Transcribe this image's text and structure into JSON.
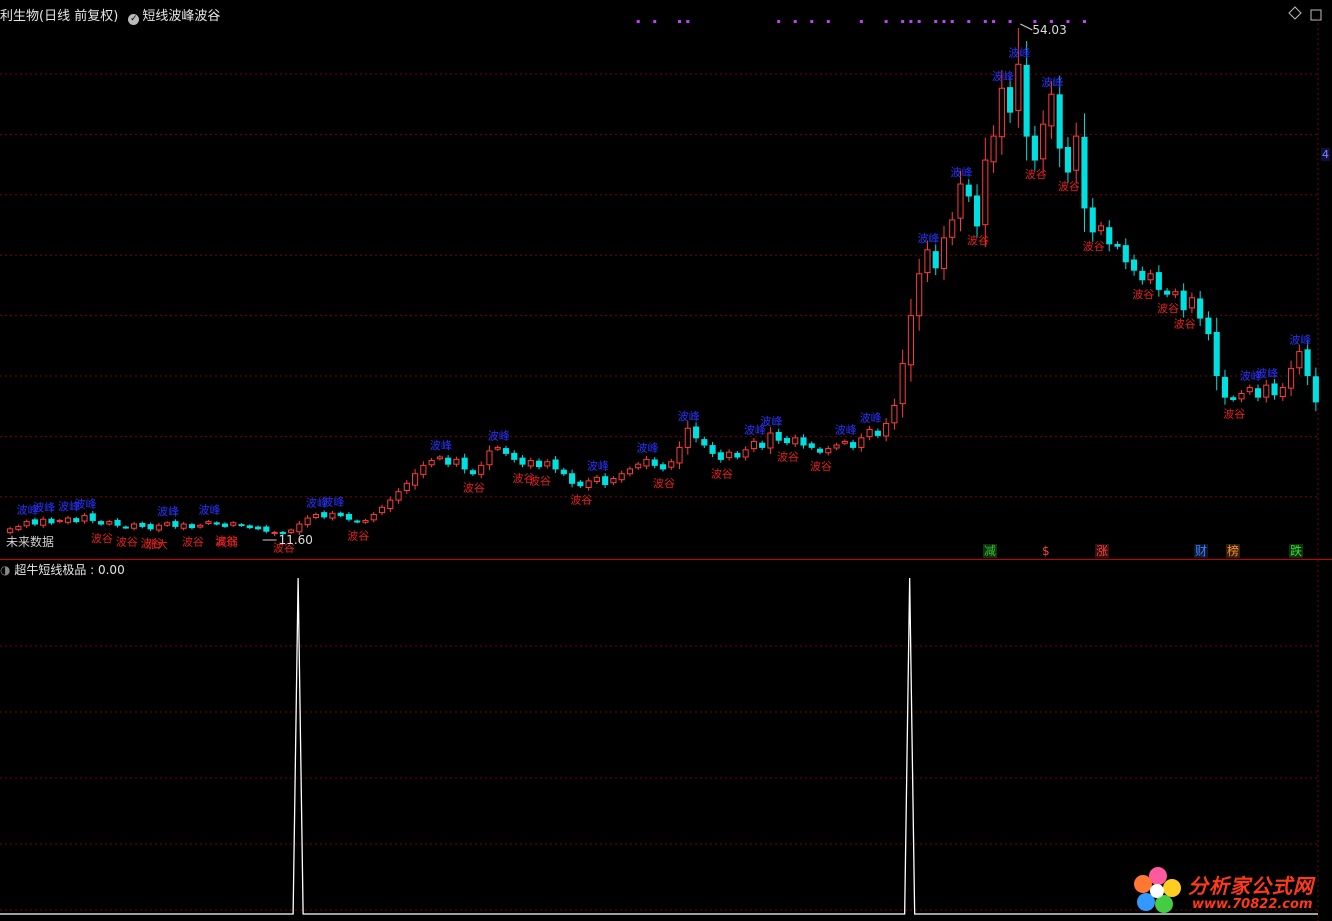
{
  "header": {
    "stock_title": "利生物(日线 前复权)",
    "indicator_name": "短线波峰波谷"
  },
  "indicator_panel": {
    "label": "超牛短线极品 : 0.00"
  },
  "price_labels": {
    "high": "54.03",
    "low": "11.60",
    "right_edge": "4"
  },
  "watermark": {
    "line1": "分析家公式网",
    "line2": "www.70822.com"
  },
  "colors": {
    "up": "#ff3c3c",
    "down": "#00e0e0",
    "peak_label": "#2a32ff",
    "valley_label": "#e02020",
    "grid": "#7a0000",
    "separator": "#c80000",
    "marker": "#c040ff"
  },
  "event_tags": [
    {
      "text": "减",
      "color": "#30c030",
      "bg": "#103010"
    },
    {
      "text": "$",
      "color": "#ff4040",
      "bg": "#000"
    },
    {
      "text": "涨",
      "color": "#ff4040",
      "bg": "#301010"
    },
    {
      "text": "财",
      "color": "#4080ff",
      "bg": "#101830"
    },
    {
      "text": "榜",
      "color": "#ff9030",
      "bg": "#302010"
    },
    {
      "text": "跌",
      "color": "#30e030",
      "bg": "#103010"
    }
  ],
  "labels": {
    "peak": "波峰",
    "valley": "波谷",
    "extra1": "未来数据",
    "extra2": "涨大",
    "extra3": "减弱"
  },
  "chart_data": [
    {
      "type": "candlestick",
      "title": "",
      "y_high": 54.03,
      "y_low": 11.6,
      "close": [
        12.2,
        12.4,
        12.8,
        12.6,
        13.0,
        12.7,
        12.9,
        13.1,
        12.8,
        13.3,
        12.9,
        12.6,
        12.8,
        12.5,
        12.3,
        12.6,
        12.4,
        12.2,
        12.5,
        12.7,
        12.4,
        12.6,
        12.3,
        12.5,
        12.8,
        12.6,
        12.4,
        12.7,
        12.5,
        12.3,
        12.2,
        12.0,
        11.9,
        11.8,
        12.1,
        12.6,
        13.1,
        13.4,
        13.2,
        13.5,
        13.3,
        13.0,
        12.8,
        12.9,
        13.4,
        14.0,
        14.6,
        15.3,
        16.0,
        16.8,
        17.5,
        17.9,
        18.2,
        17.6,
        18.0,
        17.2,
        16.8,
        17.5,
        18.7,
        19.0,
        18.5,
        18.0,
        17.6,
        17.9,
        17.4,
        17.8,
        17.2,
        16.8,
        16.0,
        15.8,
        16.2,
        16.5,
        15.9,
        16.4,
        16.8,
        17.2,
        17.6,
        18.0,
        17.5,
        17.2,
        17.8,
        19.0,
        20.6,
        19.8,
        19.2,
        18.5,
        18.0,
        18.6,
        18.2,
        18.8,
        19.5,
        19.0,
        20.2,
        19.6,
        19.4,
        19.8,
        19.2,
        19.0,
        18.6,
        18.9,
        19.2,
        19.5,
        19.0,
        19.8,
        20.5,
        20.0,
        21.0,
        22.5,
        26.0,
        30.0,
        33.5,
        35.5,
        34.0,
        36.5,
        38.0,
        41.0,
        40.0,
        37.5,
        43.0,
        45.0,
        49.0,
        47.0,
        51.0,
        45.0,
        43.0,
        46.0,
        48.5,
        44.0,
        42.0,
        45.0,
        39.0,
        37.0,
        37.5,
        36.0,
        35.8,
        34.5,
        33.8,
        33.0,
        33.5,
        32.2,
        31.8,
        32.0,
        30.5,
        31.5,
        29.8,
        28.5,
        25.0,
        23.2,
        23.0,
        23.5,
        24.0,
        23.2,
        24.2,
        23.4,
        24.0,
        25.6,
        27.0,
        25.0,
        22.8
      ]
    },
    {
      "type": "line",
      "name": "超牛短线极品",
      "value": 0.0,
      "spikes_at_bar": [
        34,
        108
      ]
    }
  ]
}
